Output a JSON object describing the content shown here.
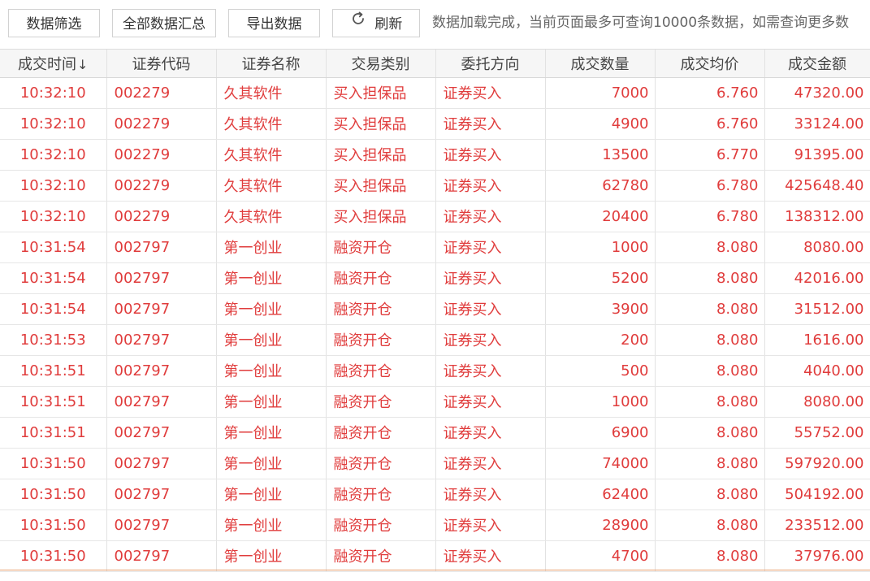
{
  "toolbar": {
    "filter_label": "数据筛选",
    "summary_label": "全部数据汇总",
    "export_label": "导出数据",
    "refresh_label": "刷新",
    "refresh_icon": "refresh-icon",
    "status_text": "数据加载完成，当前页面最多可查询10000条数据，如需查询更多数"
  },
  "table": {
    "sort_indicator": "↓",
    "columns": [
      "成交时间",
      "证券代码",
      "证券名称",
      "交易类别",
      "委托方向",
      "成交数量",
      "成交均价",
      "成交金额"
    ],
    "rows": [
      [
        "10:32:10",
        "002279",
        "久其软件",
        "买入担保品",
        "证券买入",
        "7000",
        "6.760",
        "47320.00"
      ],
      [
        "10:32:10",
        "002279",
        "久其软件",
        "买入担保品",
        "证券买入",
        "4900",
        "6.760",
        "33124.00"
      ],
      [
        "10:32:10",
        "002279",
        "久其软件",
        "买入担保品",
        "证券买入",
        "13500",
        "6.770",
        "91395.00"
      ],
      [
        "10:32:10",
        "002279",
        "久其软件",
        "买入担保品",
        "证券买入",
        "62780",
        "6.780",
        "425648.40"
      ],
      [
        "10:32:10",
        "002279",
        "久其软件",
        "买入担保品",
        "证券买入",
        "20400",
        "6.780",
        "138312.00"
      ],
      [
        "10:31:54",
        "002797",
        "第一创业",
        "融资开仓",
        "证券买入",
        "1000",
        "8.080",
        "8080.00"
      ],
      [
        "10:31:54",
        "002797",
        "第一创业",
        "融资开仓",
        "证券买入",
        "5200",
        "8.080",
        "42016.00"
      ],
      [
        "10:31:54",
        "002797",
        "第一创业",
        "融资开仓",
        "证券买入",
        "3900",
        "8.080",
        "31512.00"
      ],
      [
        "10:31:53",
        "002797",
        "第一创业",
        "融资开仓",
        "证券买入",
        "200",
        "8.080",
        "1616.00"
      ],
      [
        "10:31:51",
        "002797",
        "第一创业",
        "融资开仓",
        "证券买入",
        "500",
        "8.080",
        "4040.00"
      ],
      [
        "10:31:51",
        "002797",
        "第一创业",
        "融资开仓",
        "证券买入",
        "1000",
        "8.080",
        "8080.00"
      ],
      [
        "10:31:51",
        "002797",
        "第一创业",
        "融资开仓",
        "证券买入",
        "6900",
        "8.080",
        "55752.00"
      ],
      [
        "10:31:50",
        "002797",
        "第一创业",
        "融资开仓",
        "证券买入",
        "74000",
        "8.080",
        "597920.00"
      ],
      [
        "10:31:50",
        "002797",
        "第一创业",
        "融资开仓",
        "证券买入",
        "62400",
        "8.080",
        "504192.00"
      ],
      [
        "10:31:50",
        "002797",
        "第一创业",
        "融资开仓",
        "证券买入",
        "28900",
        "8.080",
        "233512.00"
      ],
      [
        "10:31:50",
        "002797",
        "第一创业",
        "融资开仓",
        "证券买入",
        "4700",
        "8.080",
        "37976.00"
      ]
    ]
  },
  "colors": {
    "cell_text": "#e03c3c",
    "header_bg": "#f6f6f6",
    "border": "#e2e2e2",
    "bottom_accent": "#e8a070"
  }
}
